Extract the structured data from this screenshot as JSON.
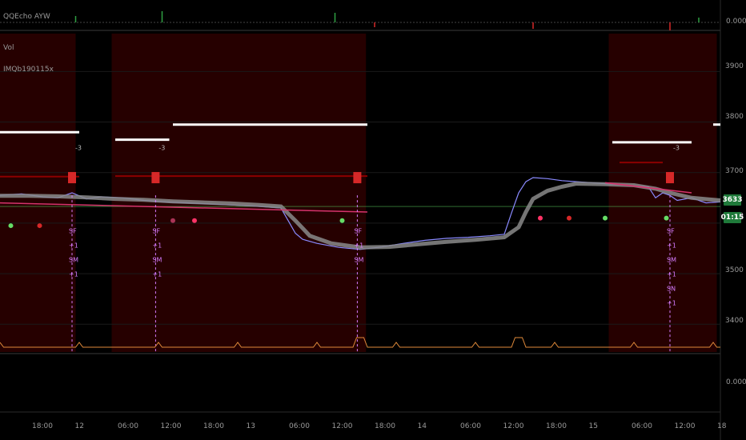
{
  "indicator_labels": [
    "QQEcho AYW",
    "Vol",
    "IMQb190115x"
  ],
  "price_axis_labels": [
    "3900",
    "3800",
    "3700",
    "3600",
    "3500",
    "3400"
  ],
  "oscillator_axis_label": "0.0000",
  "bottom_axis_label": "0.0000",
  "last_price": "3633",
  "countdown": "01:15",
  "time_labels": [
    "18:00",
    "12",
    "06:00",
    "12:00",
    "18:00",
    "13",
    "06:00",
    "12:00",
    "18:00",
    "14",
    "06:00",
    "12:00",
    "18:00",
    "15",
    "06:00",
    "12:00",
    "18"
  ],
  "colors": {
    "accent_green": "#2ea043",
    "accent_red": "#d62828",
    "zone_red": "#2a0000",
    "grid": "#1a1a1a",
    "level_line": "#ffffff",
    "signal_purple": "#d77cff"
  },
  "event_markers": [
    {
      "top": "-3",
      "sides": [
        "SF",
        "+1",
        "SM",
        "+1"
      ]
    },
    {
      "top": "-3",
      "sides": [
        "SF",
        "+1",
        "SM",
        "+1"
      ]
    },
    {
      "top": "",
      "sides": [
        "SF",
        "+1",
        "SM"
      ]
    },
    {
      "top": "-3",
      "sides": [
        "SF",
        "+1",
        "SM",
        "+1",
        "SN",
        "+1"
      ]
    }
  ],
  "chart_data": {
    "type": "line",
    "price_axis": {
      "ticks": [
        3900,
        3800,
        3700,
        3600,
        3500,
        3400
      ],
      "ylim": [
        3345,
        3975
      ]
    },
    "time_axis": [
      "18:00",
      "12",
      "06:00",
      "12:00",
      "18:00",
      "13",
      "06:00",
      "12:00",
      "18:00",
      "14",
      "06:00",
      "12:00",
      "18:00",
      "15",
      "06:00",
      "12:00",
      "18"
    ],
    "series": [
      {
        "color": "#8a8aff",
        "x": [
          0,
          3,
          6,
          8,
          10,
          12,
          14,
          17,
          20,
          23,
          26,
          29,
          32,
          35,
          37,
          39,
          40,
          41,
          42,
          44,
          47,
          50,
          53,
          56,
          59,
          62,
          65,
          68,
          70,
          71,
          72,
          73,
          74,
          76,
          78,
          80,
          82,
          84,
          86,
          88,
          90,
          91,
          92,
          93,
          94,
          96,
          98,
          100
        ],
        "values": [
          3655,
          3658,
          3652,
          3650,
          3660,
          3648,
          3652,
          3650,
          3645,
          3642,
          3640,
          3638,
          3636,
          3634,
          3632,
          3630,
          3605,
          3580,
          3568,
          3560,
          3552,
          3548,
          3553,
          3560,
          3566,
          3570,
          3572,
          3575,
          3578,
          3620,
          3660,
          3682,
          3690,
          3688,
          3684,
          3682,
          3680,
          3678,
          3676,
          3674,
          3672,
          3650,
          3660,
          3655,
          3645,
          3650,
          3640,
          3642
        ]
      },
      {
        "color": "#8a8a8a",
        "x": [
          0,
          4,
          8,
          12,
          16,
          20,
          24,
          28,
          32,
          36,
          39,
          41,
          43,
          46,
          50,
          54,
          58,
          62,
          66,
          70,
          72,
          73,
          74,
          76,
          78,
          80,
          84,
          88,
          91,
          93,
          96,
          100
        ],
        "values": [
          3654,
          3654,
          3653,
          3651,
          3648,
          3646,
          3643,
          3641,
          3639,
          3636,
          3633,
          3605,
          3575,
          3560,
          3552,
          3553,
          3558,
          3563,
          3567,
          3572,
          3592,
          3622,
          3648,
          3664,
          3672,
          3678,
          3677,
          3675,
          3668,
          3660,
          3650,
          3645
        ]
      }
    ],
    "level_lines": [
      3780,
      3765,
      3795,
      3760,
      3795,
      3770
    ],
    "rsi_vertical_x": [
      10,
      21.6,
      49.6,
      93
    ]
  }
}
